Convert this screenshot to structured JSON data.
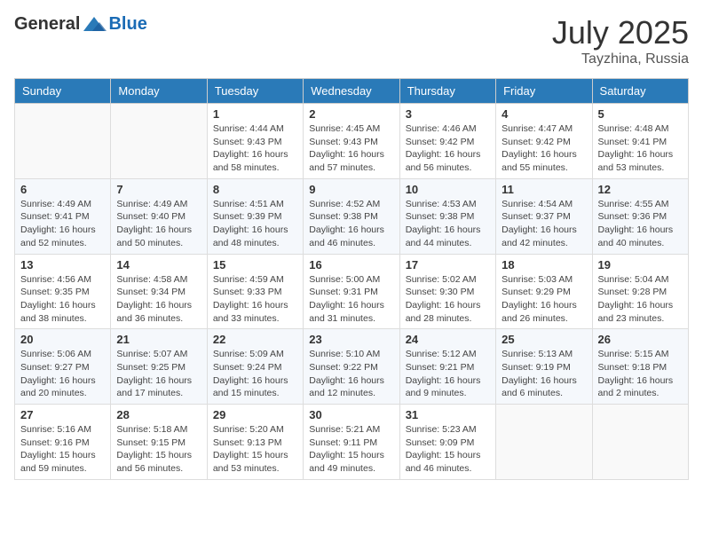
{
  "header": {
    "logo_general": "General",
    "logo_blue": "Blue",
    "month": "July 2025",
    "location": "Tayzhina, Russia"
  },
  "weekdays": [
    "Sunday",
    "Monday",
    "Tuesday",
    "Wednesday",
    "Thursday",
    "Friday",
    "Saturday"
  ],
  "weeks": [
    [
      {
        "day": "",
        "info": ""
      },
      {
        "day": "",
        "info": ""
      },
      {
        "day": "1",
        "info": "Sunrise: 4:44 AM\nSunset: 9:43 PM\nDaylight: 16 hours and 58 minutes."
      },
      {
        "day": "2",
        "info": "Sunrise: 4:45 AM\nSunset: 9:43 PM\nDaylight: 16 hours and 57 minutes."
      },
      {
        "day": "3",
        "info": "Sunrise: 4:46 AM\nSunset: 9:42 PM\nDaylight: 16 hours and 56 minutes."
      },
      {
        "day": "4",
        "info": "Sunrise: 4:47 AM\nSunset: 9:42 PM\nDaylight: 16 hours and 55 minutes."
      },
      {
        "day": "5",
        "info": "Sunrise: 4:48 AM\nSunset: 9:41 PM\nDaylight: 16 hours and 53 minutes."
      }
    ],
    [
      {
        "day": "6",
        "info": "Sunrise: 4:49 AM\nSunset: 9:41 PM\nDaylight: 16 hours and 52 minutes."
      },
      {
        "day": "7",
        "info": "Sunrise: 4:49 AM\nSunset: 9:40 PM\nDaylight: 16 hours and 50 minutes."
      },
      {
        "day": "8",
        "info": "Sunrise: 4:51 AM\nSunset: 9:39 PM\nDaylight: 16 hours and 48 minutes."
      },
      {
        "day": "9",
        "info": "Sunrise: 4:52 AM\nSunset: 9:38 PM\nDaylight: 16 hours and 46 minutes."
      },
      {
        "day": "10",
        "info": "Sunrise: 4:53 AM\nSunset: 9:38 PM\nDaylight: 16 hours and 44 minutes."
      },
      {
        "day": "11",
        "info": "Sunrise: 4:54 AM\nSunset: 9:37 PM\nDaylight: 16 hours and 42 minutes."
      },
      {
        "day": "12",
        "info": "Sunrise: 4:55 AM\nSunset: 9:36 PM\nDaylight: 16 hours and 40 minutes."
      }
    ],
    [
      {
        "day": "13",
        "info": "Sunrise: 4:56 AM\nSunset: 9:35 PM\nDaylight: 16 hours and 38 minutes."
      },
      {
        "day": "14",
        "info": "Sunrise: 4:58 AM\nSunset: 9:34 PM\nDaylight: 16 hours and 36 minutes."
      },
      {
        "day": "15",
        "info": "Sunrise: 4:59 AM\nSunset: 9:33 PM\nDaylight: 16 hours and 33 minutes."
      },
      {
        "day": "16",
        "info": "Sunrise: 5:00 AM\nSunset: 9:31 PM\nDaylight: 16 hours and 31 minutes."
      },
      {
        "day": "17",
        "info": "Sunrise: 5:02 AM\nSunset: 9:30 PM\nDaylight: 16 hours and 28 minutes."
      },
      {
        "day": "18",
        "info": "Sunrise: 5:03 AM\nSunset: 9:29 PM\nDaylight: 16 hours and 26 minutes."
      },
      {
        "day": "19",
        "info": "Sunrise: 5:04 AM\nSunset: 9:28 PM\nDaylight: 16 hours and 23 minutes."
      }
    ],
    [
      {
        "day": "20",
        "info": "Sunrise: 5:06 AM\nSunset: 9:27 PM\nDaylight: 16 hours and 20 minutes."
      },
      {
        "day": "21",
        "info": "Sunrise: 5:07 AM\nSunset: 9:25 PM\nDaylight: 16 hours and 17 minutes."
      },
      {
        "day": "22",
        "info": "Sunrise: 5:09 AM\nSunset: 9:24 PM\nDaylight: 16 hours and 15 minutes."
      },
      {
        "day": "23",
        "info": "Sunrise: 5:10 AM\nSunset: 9:22 PM\nDaylight: 16 hours and 12 minutes."
      },
      {
        "day": "24",
        "info": "Sunrise: 5:12 AM\nSunset: 9:21 PM\nDaylight: 16 hours and 9 minutes."
      },
      {
        "day": "25",
        "info": "Sunrise: 5:13 AM\nSunset: 9:19 PM\nDaylight: 16 hours and 6 minutes."
      },
      {
        "day": "26",
        "info": "Sunrise: 5:15 AM\nSunset: 9:18 PM\nDaylight: 16 hours and 2 minutes."
      }
    ],
    [
      {
        "day": "27",
        "info": "Sunrise: 5:16 AM\nSunset: 9:16 PM\nDaylight: 15 hours and 59 minutes."
      },
      {
        "day": "28",
        "info": "Sunrise: 5:18 AM\nSunset: 9:15 PM\nDaylight: 15 hours and 56 minutes."
      },
      {
        "day": "29",
        "info": "Sunrise: 5:20 AM\nSunset: 9:13 PM\nDaylight: 15 hours and 53 minutes."
      },
      {
        "day": "30",
        "info": "Sunrise: 5:21 AM\nSunset: 9:11 PM\nDaylight: 15 hours and 49 minutes."
      },
      {
        "day": "31",
        "info": "Sunrise: 5:23 AM\nSunset: 9:09 PM\nDaylight: 15 hours and 46 minutes."
      },
      {
        "day": "",
        "info": ""
      },
      {
        "day": "",
        "info": ""
      }
    ]
  ]
}
